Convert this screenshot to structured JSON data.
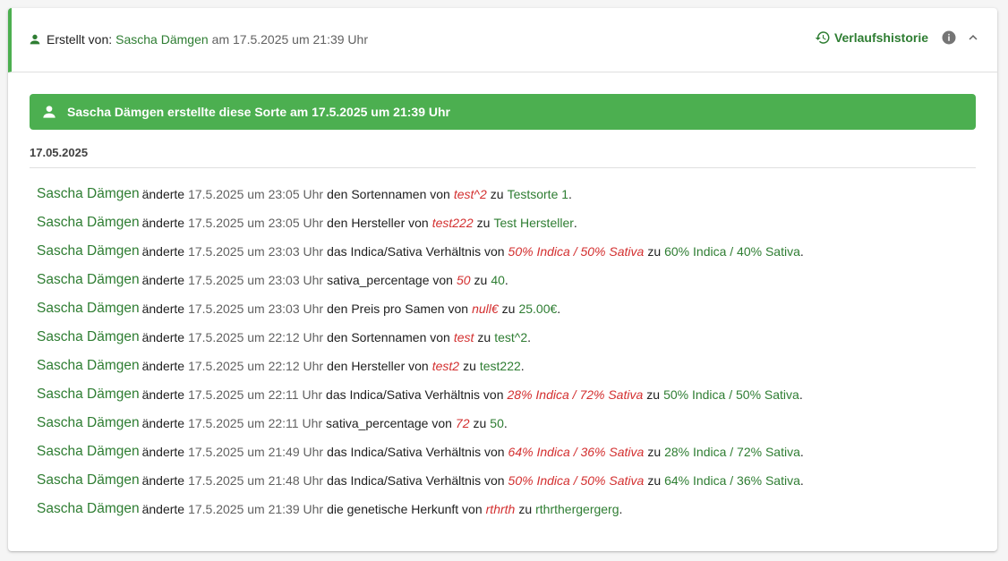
{
  "header": {
    "created_label": "Erstellt von:",
    "creator_name": "Sascha Dämgen",
    "created_at": "am 17.5.2025 um 21:39 Uhr",
    "history_label": "Verlaufshistorie"
  },
  "banner": {
    "text": "Sascha Dämgen erstellte diese Sorte am 17.5.2025 um 21:39 Uhr"
  },
  "date_group": "17.05.2025",
  "entries": [
    {
      "user": "Sascha Dämgen",
      "verb": "änderte",
      "time": "17.5.2025 um 23:05 Uhr",
      "field": "den Sortennamen von",
      "old": "test^2",
      "conn": "zu",
      "new": "Testsorte 1",
      "end": "."
    },
    {
      "user": "Sascha Dämgen",
      "verb": "änderte",
      "time": "17.5.2025 um 23:05 Uhr",
      "field": "den Hersteller von",
      "old": "test222",
      "conn": "zu",
      "new": "Test Hersteller",
      "end": "."
    },
    {
      "user": "Sascha Dämgen",
      "verb": "änderte",
      "time": "17.5.2025 um 23:03 Uhr",
      "field": "das Indica/Sativa Verhältnis von",
      "old": "50% Indica / 50% Sativa",
      "conn": "zu",
      "new": "60% Indica / 40% Sativa",
      "end": "."
    },
    {
      "user": "Sascha Dämgen",
      "verb": "änderte",
      "time": "17.5.2025 um 23:03 Uhr",
      "field": "sativa_percentage von",
      "old": "50",
      "conn": "zu",
      "new": "40",
      "end": "."
    },
    {
      "user": "Sascha Dämgen",
      "verb": "änderte",
      "time": "17.5.2025 um 23:03 Uhr",
      "field": "den Preis pro Samen von",
      "old": "null€",
      "conn": "zu",
      "new": "25.00€",
      "end": "."
    },
    {
      "user": "Sascha Dämgen",
      "verb": "änderte",
      "time": "17.5.2025 um 22:12 Uhr",
      "field": "den Sortennamen von",
      "old": "test",
      "conn": "zu",
      "new": "test^2",
      "end": "."
    },
    {
      "user": "Sascha Dämgen",
      "verb": "änderte",
      "time": "17.5.2025 um 22:12 Uhr",
      "field": "den Hersteller von",
      "old": "test2",
      "conn": "zu",
      "new": "test222",
      "end": "."
    },
    {
      "user": "Sascha Dämgen",
      "verb": "änderte",
      "time": "17.5.2025 um 22:11 Uhr",
      "field": "das Indica/Sativa Verhältnis von",
      "old": "28% Indica / 72% Sativa",
      "conn": "zu",
      "new": "50% Indica / 50% Sativa",
      "end": "."
    },
    {
      "user": "Sascha Dämgen",
      "verb": "änderte",
      "time": "17.5.2025 um 22:11 Uhr",
      "field": "sativa_percentage von",
      "old": "72",
      "conn": "zu",
      "new": "50",
      "end": "."
    },
    {
      "user": "Sascha Dämgen",
      "verb": "änderte",
      "time": "17.5.2025 um 21:49 Uhr",
      "field": "das Indica/Sativa Verhältnis von",
      "old": "64% Indica / 36% Sativa",
      "conn": "zu",
      "new": "28% Indica / 72% Sativa",
      "end": "."
    },
    {
      "user": "Sascha Dämgen",
      "verb": "änderte",
      "time": "17.5.2025 um 21:48 Uhr",
      "field": "das Indica/Sativa Verhältnis von",
      "old": "50% Indica / 50% Sativa",
      "conn": "zu",
      "new": "64% Indica / 36% Sativa",
      "end": "."
    },
    {
      "user": "Sascha Dämgen",
      "verb": "änderte",
      "time": "17.5.2025 um 21:39 Uhr",
      "field": "die genetische Herkunft von",
      "old": "rthrth",
      "conn": "zu",
      "new": "rthrthergergerg",
      "end": "."
    }
  ],
  "icons": {
    "creator": "person-icon",
    "history": "history-icon",
    "info": "info-icon",
    "collapse": "chevron-up-icon",
    "banner": "person-icon"
  },
  "colors": {
    "accent": "#4caf50",
    "name_green": "#2e7d32",
    "old_red": "#d32f2f"
  }
}
